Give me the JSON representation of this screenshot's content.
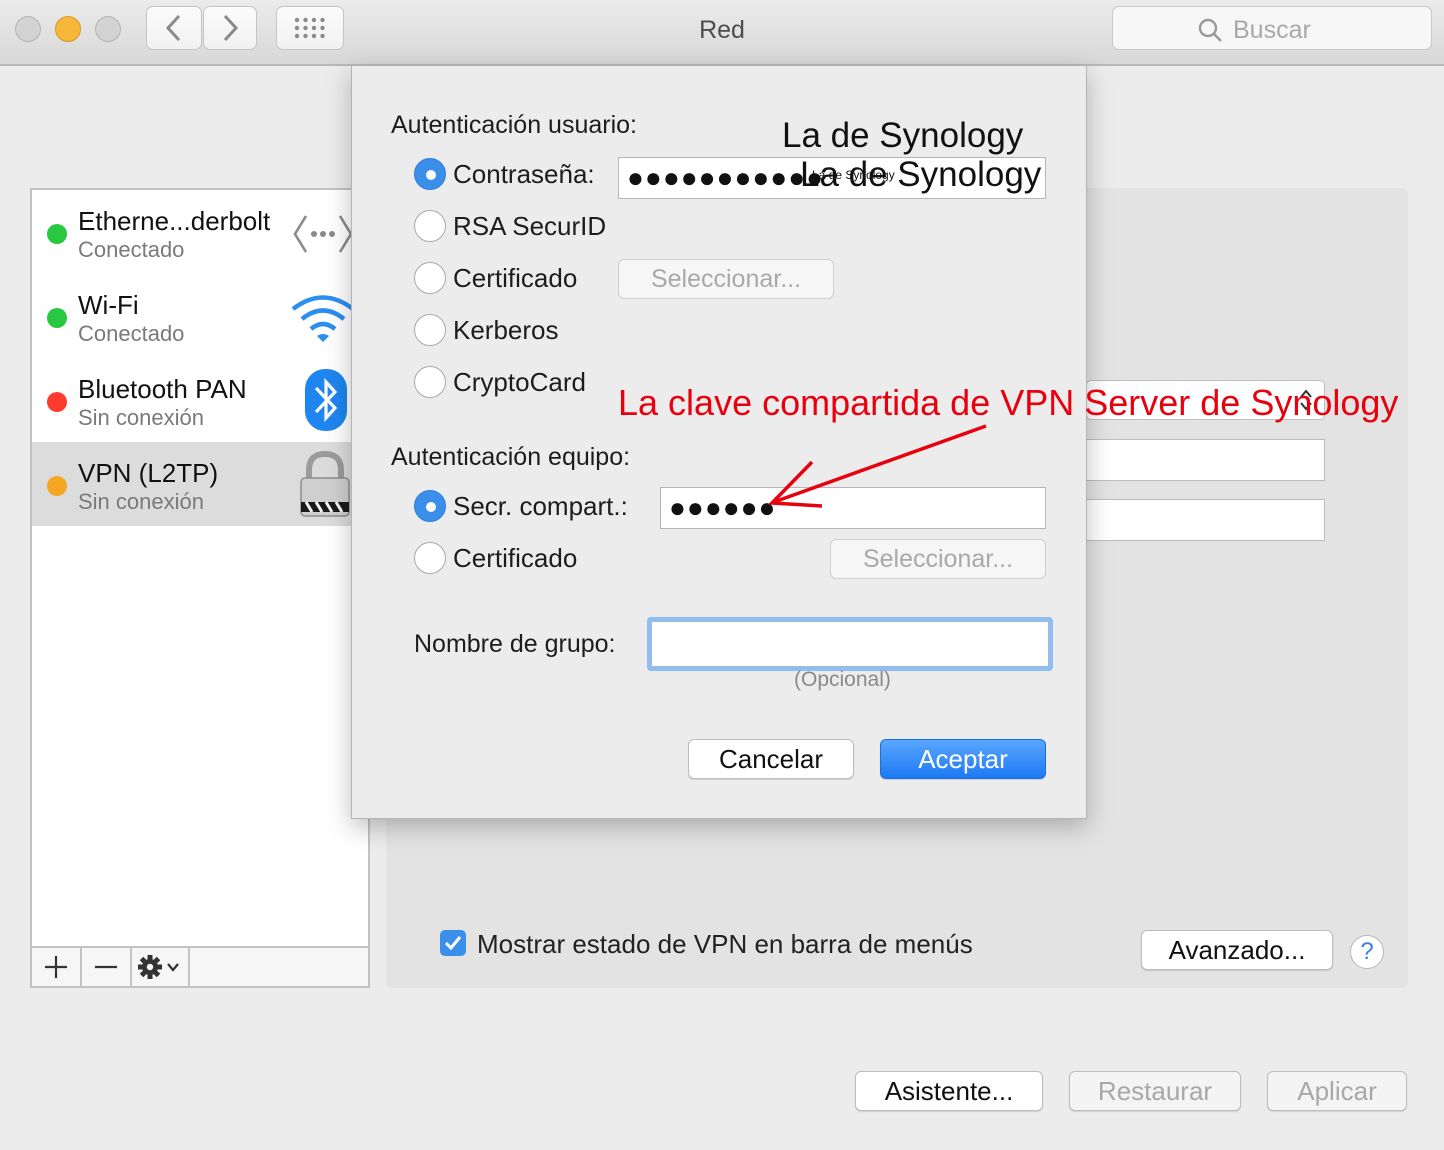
{
  "window": {
    "title": "Red",
    "search_placeholder": "Buscar"
  },
  "services": [
    {
      "name": "Etherne...derbolt",
      "status": "Conectado",
      "status_color": "#28c840",
      "icon": "ethernet-icon"
    },
    {
      "name": "Wi-Fi",
      "status": "Conectado",
      "status_color": "#28c840",
      "icon": "wifi-icon"
    },
    {
      "name": "Bluetooth PAN",
      "status": "Sin conexión",
      "status_color": "#ff3b30",
      "icon": "bluetooth-icon"
    },
    {
      "name": "VPN (L2TP)",
      "status": "Sin conexión",
      "status_color": "#f5a623",
      "icon": "vpn-lock-icon",
      "selected": true
    }
  ],
  "list_bar": {
    "add": "+",
    "remove": "−",
    "actions": "gear-icon"
  },
  "sheet": {
    "user_auth_label": "Autenticación usuario:",
    "user_auth_options": [
      {
        "label": "Contraseña:",
        "selected": true
      },
      {
        "label": "RSA SecurID",
        "selected": false
      },
      {
        "label": "Certificado",
        "selected": false
      },
      {
        "label": "Kerberos",
        "selected": false
      },
      {
        "label": "CryptoCard",
        "selected": false
      }
    ],
    "password_value": "●●●●●●●●●●●",
    "select_button": "Seleccionar...",
    "machine_auth_label": "Autenticación equipo:",
    "machine_auth_options": [
      {
        "label": "Secr. compart.:",
        "selected": true
      },
      {
        "label": "Certificado",
        "selected": false
      }
    ],
    "shared_secret_value": "●●●●●●",
    "select_button_2": "Seleccionar...",
    "group_name_label": "Nombre de grupo:",
    "group_name_value": "",
    "group_name_hint": "(Opcional)",
    "cancel": "Cancelar",
    "accept": "Aceptar"
  },
  "annotations": {
    "synology_1": "La de Synology",
    "synology_2": "La de Synology",
    "synology_tiny": "La de Synology",
    "shared_key_note": "La clave compartida de VPN Server de Synology",
    "note_color": "#e8000f"
  },
  "footer": {
    "show_vpn_status": "Mostrar estado de VPN en barra de menús",
    "show_vpn_status_checked": true,
    "advanced": "Avanzado...",
    "help": "?",
    "assistant": "Asistente...",
    "revert": "Restaurar",
    "apply": "Aplicar"
  }
}
